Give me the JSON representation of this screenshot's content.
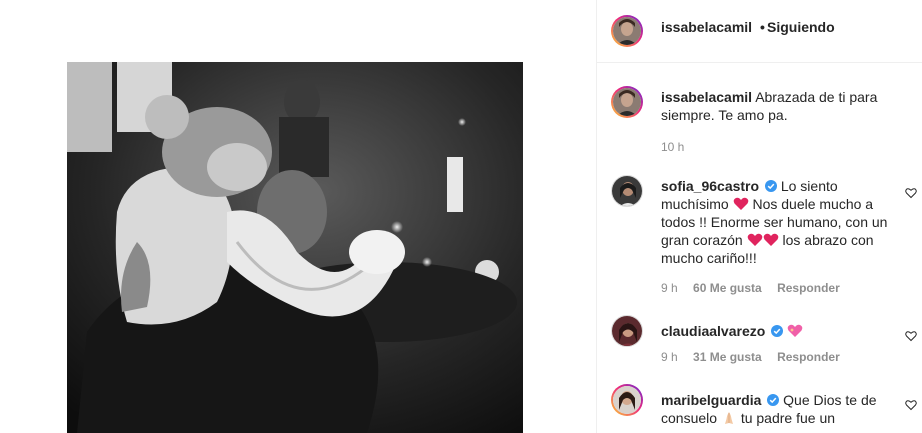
{
  "post": {
    "author": "issabelacamil",
    "follow_status": "Siguiendo",
    "caption": "Abrazada de ti para siempre. Te amo pa.",
    "caption_time": "10 h"
  },
  "comments": [
    {
      "user": "sofia_96castro",
      "verified": true,
      "text_parts": [
        "Lo siento muchísimo ",
        " Nos duele mucho a todos !! Enorme ser humano, con un gran corazón ",
        " los abrazo con mucho cariño!!!"
      ],
      "time": "9 h",
      "likes": "60 Me gusta",
      "reply": "Responder"
    },
    {
      "user": "claudiaalvarezo",
      "verified": true,
      "time": "9 h",
      "likes": "31 Me gusta",
      "reply": "Responder"
    },
    {
      "user": "maribelguardia",
      "verified": true,
      "text_parts": [
        "Que Dios te de consuelo ",
        " tu padre fue un"
      ]
    }
  ],
  "icons": {
    "verified": "verified-badge-icon",
    "like": "heart-outline-icon",
    "red_heart": "red-heart-emoji",
    "sparkle_heart": "sparkling-heart-emoji",
    "praying": "praying-hands-emoji"
  },
  "colors": {
    "verified": "#3897f0",
    "red_heart": "#e0245e",
    "sparkle_heart": "#f060a8",
    "meta": "#8e8e8e",
    "story_ring_start": "#f9ce34",
    "story_ring_end": "#6228d7"
  }
}
